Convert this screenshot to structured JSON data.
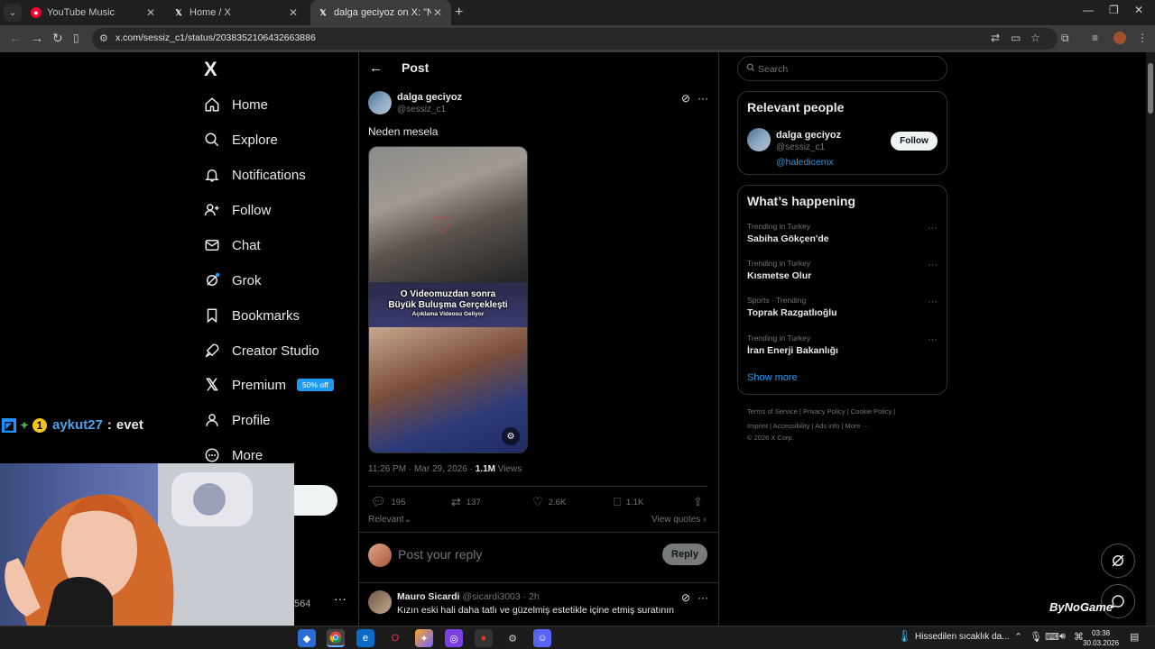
{
  "browser": {
    "tabs": [
      {
        "title": "YouTube Music",
        "active": false
      },
      {
        "title": "Home / X",
        "active": false
      },
      {
        "title": "dalga geciyoz on X: \"Neden me",
        "active": true
      }
    ],
    "url": "x.com/sessiz_c1/status/2038352106432663886"
  },
  "nav": {
    "logo": "X",
    "items": [
      {
        "label": "Home",
        "icon": "home-icon"
      },
      {
        "label": "Explore",
        "icon": "search-icon"
      },
      {
        "label": "Notifications",
        "icon": "bell-icon"
      },
      {
        "label": "Follow",
        "icon": "person-add-icon"
      },
      {
        "label": "Chat",
        "icon": "mail-icon"
      },
      {
        "label": "Grok",
        "icon": "grok-icon"
      },
      {
        "label": "Bookmarks",
        "icon": "bookmark-icon"
      },
      {
        "label": "Creator Studio",
        "icon": "rocket-icon"
      },
      {
        "label": "Premium",
        "icon": "x-icon"
      },
      {
        "label": "Profile",
        "icon": "person-icon"
      },
      {
        "label": "More",
        "icon": "more-circle-icon"
      }
    ],
    "premium_badge": "50% off",
    "side_count": "564"
  },
  "chat_overlay": {
    "user": "aykut27",
    "separator": ":",
    "message": "evet"
  },
  "post": {
    "header": "Post",
    "author_name": "dalga geciyoz",
    "author_handle": "@sessiz_c1",
    "text": "Neden mesela",
    "media_caption_1": "O Videomuzdan sonra",
    "media_caption_2": "Büyük Buluşma Gerçekleşti",
    "media_caption_3": "Açıklama Videosu Geliyor",
    "timestamp": "11:26 PM · Mar 29, 2026 · ",
    "views_count": "1.1M",
    "views_label": " Views",
    "stats": {
      "replies": "195",
      "reposts": "137",
      "likes": "2.6K",
      "bookmarks": "1.1K"
    },
    "sort_label": "Relevant",
    "view_quotes": "View quotes",
    "reply_placeholder": "Post your reply",
    "reply_button": "Reply"
  },
  "first_reply": {
    "name": "Mauro Sicardi",
    "handle_time": " @sicardi3003 · 2h",
    "text": "Kızın eski hali daha tatlı ve güzelmiş estetikle içine etmiş suratının"
  },
  "right": {
    "search_placeholder": "Search",
    "relevant_title": "Relevant people",
    "person": {
      "name": "dalga geciyoz",
      "handle": "@sessiz_c1",
      "bio": "@haledicemx",
      "follow_label": "Follow"
    },
    "happening_title": "What’s happening",
    "trends": [
      {
        "context": "Trending in Turkey",
        "name": "Sabiha Gökçen'de"
      },
      {
        "context": "Trending in Turkey",
        "name": "Kısmetse Olur"
      },
      {
        "context": "Sports · Trending",
        "name": "Toprak Razgatlıoğlu"
      },
      {
        "context": "Trending in Turkey",
        "name": "İran Enerji Bakanlığı"
      }
    ],
    "show_more": "Show more",
    "footer_line1": "Terms of Service  |   Privacy Policy  |   Cookie Policy  |",
    "footer_line2": "Imprint  |   Accessibility  |   Ads info  |   More ···",
    "footer_line3": "© 2026 X Corp."
  },
  "overlay_brand": "ByNoGame",
  "taskbar": {
    "weather": "Hissedilen sıcaklık da...",
    "time": "03:38",
    "date": "30.03.2026"
  },
  "colors": {
    "accent": "#1d9bf0",
    "background": "#000000",
    "border": "#2f3336",
    "muted": "#71767b"
  }
}
